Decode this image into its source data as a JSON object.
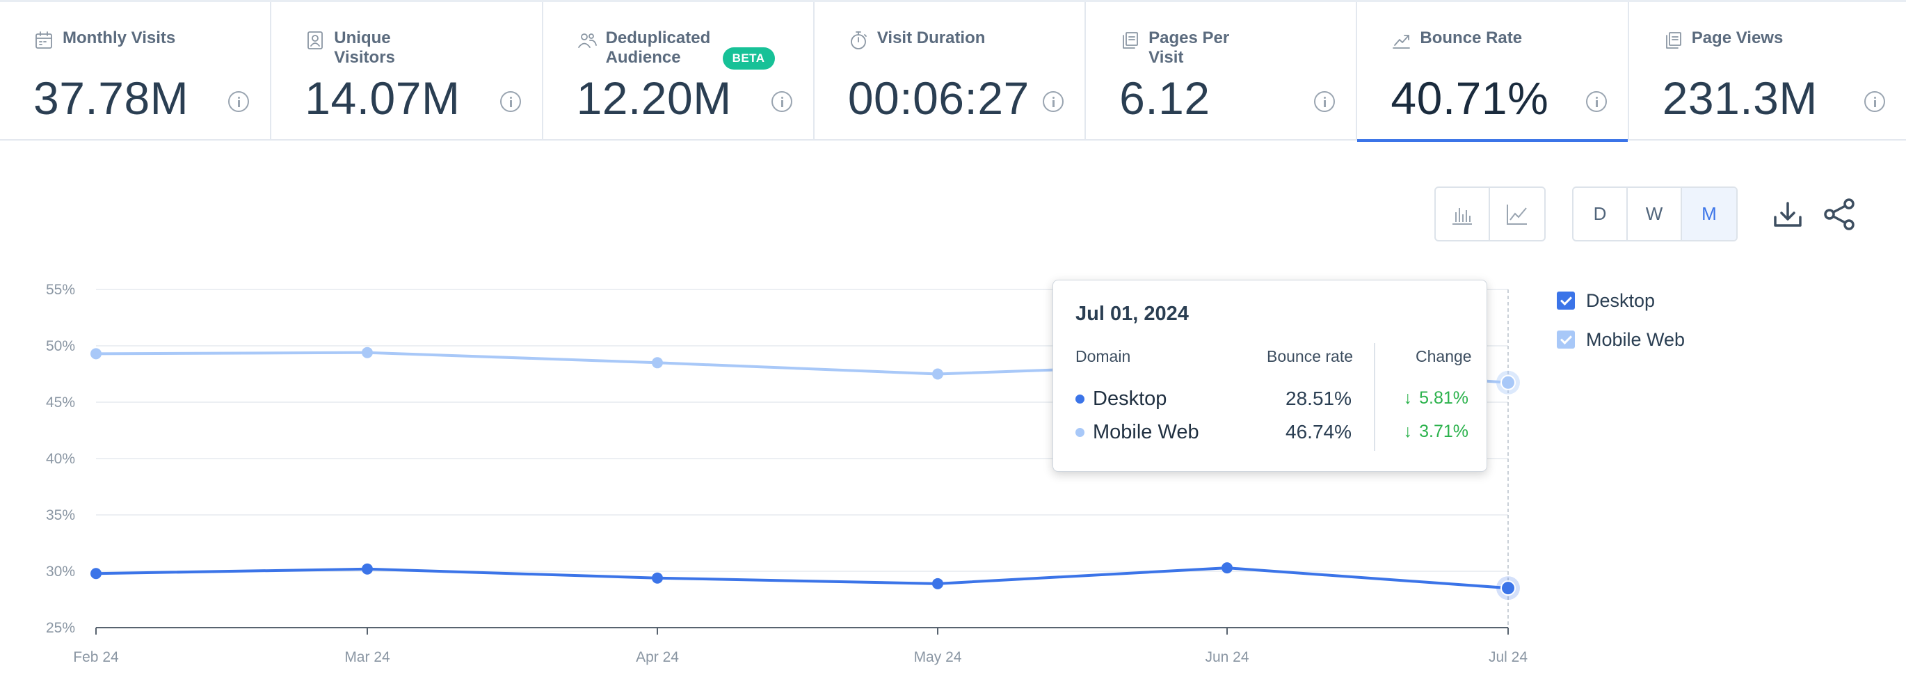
{
  "metrics": [
    {
      "label": "Monthly Visits",
      "value": "37.78M",
      "icon": "calendar-icon"
    },
    {
      "label": "Unique Visitors",
      "value": "14.07M",
      "icon": "user-card-icon"
    },
    {
      "label": "Deduplicated Audience",
      "value": "12.20M",
      "icon": "users-icon",
      "badge": "BETA"
    },
    {
      "label": "Visit Duration",
      "value": "00:06:27",
      "icon": "stopwatch-icon"
    },
    {
      "label": "Pages Per Visit",
      "value": "6.12",
      "icon": "pages-icon"
    },
    {
      "label": "Bounce Rate",
      "value": "40.71%",
      "icon": "trend-icon",
      "active": true
    },
    {
      "label": "Page Views",
      "value": "231.3M",
      "icon": "pages-icon"
    }
  ],
  "toolbar": {
    "granularity": [
      "D",
      "W",
      "M"
    ],
    "granularity_active": "M"
  },
  "legend": {
    "desktop": "Desktop",
    "mobile": "Mobile Web"
  },
  "tooltip": {
    "date": "Jul 01, 2024",
    "col_domain": "Domain",
    "col_rate": "Bounce rate",
    "col_change": "Change",
    "rows": [
      {
        "name": "Desktop",
        "rate": "28.51%",
        "change": "5.81%"
      },
      {
        "name": "Mobile Web",
        "rate": "46.74%",
        "change": "3.71%"
      }
    ]
  },
  "colors": {
    "desktop": "#3b74e8",
    "mobile": "#a8c8f8",
    "accent": "#3b74e8",
    "beta": "#17c197",
    "positive": "#2bb24c"
  },
  "chart_data": {
    "type": "line",
    "categories": [
      "Feb 24",
      "Mar 24",
      "Apr 24",
      "May 24",
      "Jun 24",
      "Jul 24"
    ],
    "series": [
      {
        "name": "Desktop",
        "values": [
          29.8,
          30.2,
          29.4,
          28.9,
          30.3,
          28.51
        ]
      },
      {
        "name": "Mobile Web",
        "values": [
          49.3,
          49.4,
          48.5,
          47.5,
          48.4,
          46.74
        ]
      }
    ],
    "y_ticks": [
      "55%",
      "50%",
      "45%",
      "40%",
      "35%",
      "30%",
      "25%"
    ],
    "ylim": [
      25,
      55
    ],
    "grid": true,
    "legend": "right",
    "highlight_index": 5
  }
}
